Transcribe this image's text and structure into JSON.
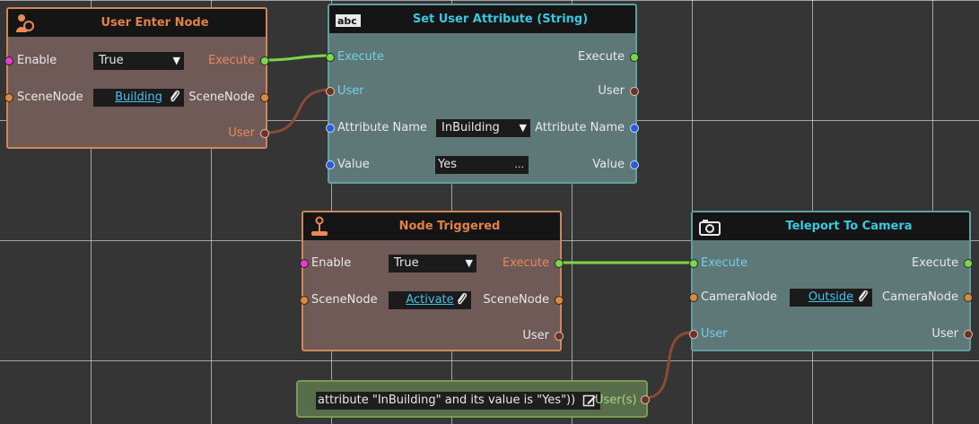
{
  "nodes": {
    "user_enter": {
      "title": "User Enter Node",
      "enable_label": "Enable",
      "enable_value": "True",
      "scene_in_label": "SceneNode",
      "scene_value": "Building",
      "execute_label": "Execute",
      "scene_out_label": "SceneNode",
      "user_label": "User"
    },
    "set_attr": {
      "title": "Set User Attribute (String)",
      "execute_in_label": "Execute",
      "execute_out_label": "Execute",
      "user_in_label": "User",
      "user_out_label": "User",
      "attr_name_in_label": "Attribute Name",
      "attr_name_value": "InBuilding",
      "attr_name_out_label": "Attribute Name",
      "value_in_label": "Value",
      "value_value": "Yes",
      "value_more": "...",
      "value_out_label": "Value"
    },
    "node_triggered": {
      "title": "Node Triggered",
      "enable_label": "Enable",
      "enable_value": "True",
      "scene_in_label": "SceneNode",
      "scene_value": "Activate",
      "execute_label": "Execute",
      "scene_out_label": "SceneNode",
      "user_label": "User"
    },
    "teleport": {
      "title": "Teleport To Camera",
      "execute_in_label": "Execute",
      "execute_out_label": "Execute",
      "camera_in_label": "CameraNode",
      "camera_value": "Outside",
      "camera_out_label": "CameraNode",
      "user_in_label": "User",
      "user_out_label": "User"
    },
    "filter": {
      "expression": "attribute \"InBuilding\" and its value is \"Yes\"))",
      "output_label": "User(s)"
    }
  },
  "icons": {
    "user_enter": "user-enter-icon",
    "set_attr": "text-abc-icon",
    "node_triggered": "joystick-icon",
    "teleport": "camera-icon",
    "dropdown": "triangle-down-icon",
    "link": "paperclip-icon",
    "edit": "edit-icon"
  },
  "colors": {
    "orange_node_border": "#cf875a",
    "teal_node_border": "#5fa0a0",
    "green_node_border": "#7a9a55",
    "execute_wire": "#7cd64c",
    "user_wire": "#8c4a38",
    "link_text": "#46c2ee",
    "orange_title": "#e0824a",
    "teal_title": "#38c9e0"
  }
}
